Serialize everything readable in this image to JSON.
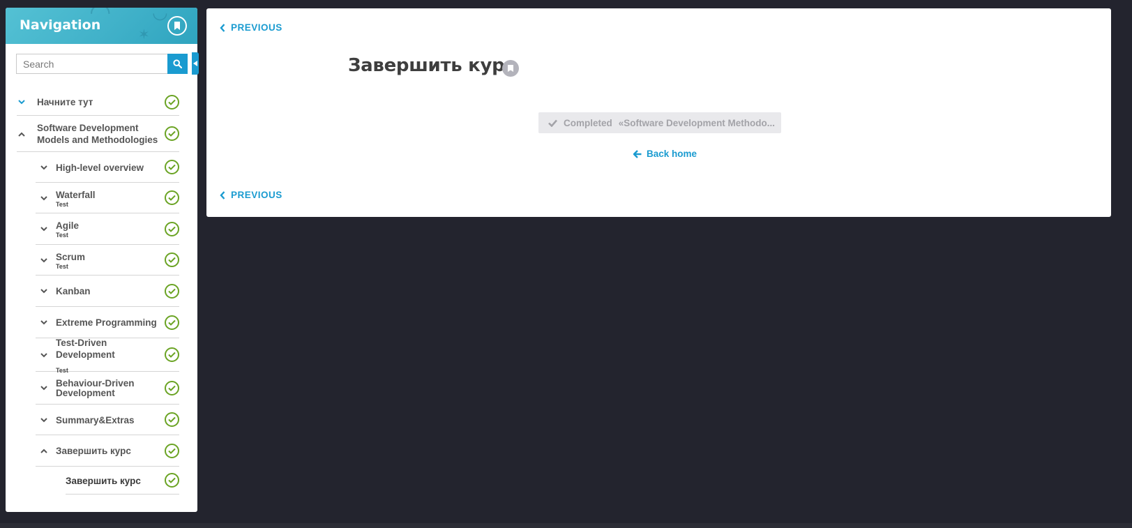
{
  "sidebar": {
    "title": "Navigation",
    "search_placeholder": "Search",
    "items": [
      {
        "label": "Начните тут",
        "sub": ""
      },
      {
        "label": "Software Development Models and Methodologies",
        "sub": ""
      },
      {
        "label": "High-level overview",
        "sub": ""
      },
      {
        "label": "Waterfall",
        "sub": "Test"
      },
      {
        "label": "Agile",
        "sub": "Test"
      },
      {
        "label": "Scrum",
        "sub": "Test"
      },
      {
        "label": "Kanban",
        "sub": ""
      },
      {
        "label": "Extreme Programming",
        "sub": ""
      },
      {
        "label": "Test-Driven Development",
        "sub": "Test"
      },
      {
        "label": "Behaviour-Driven Development",
        "sub": ""
      },
      {
        "label": "Summary&Extras",
        "sub": ""
      },
      {
        "label": "Завершить курс",
        "sub": ""
      },
      {
        "label": "Завершить курс",
        "sub": ""
      }
    ]
  },
  "main": {
    "prev_label": "PREVIOUS",
    "title": "Завершить курс",
    "completed_label": "Completed",
    "completed_course": "«Software Development Methodo...",
    "back_home_label": "Back home"
  },
  "colors": {
    "accent": "#1a9bd0",
    "check_green": "#6aa323",
    "page_bg": "#23242e",
    "header_teal": "#3fb0c8"
  },
  "icons": {
    "header_bookmark": "bookmark-icon",
    "search": "search-icon",
    "completed_check": "check-circle-icon",
    "prev": "chevron-left-icon",
    "back_home": "arrow-left-icon"
  }
}
